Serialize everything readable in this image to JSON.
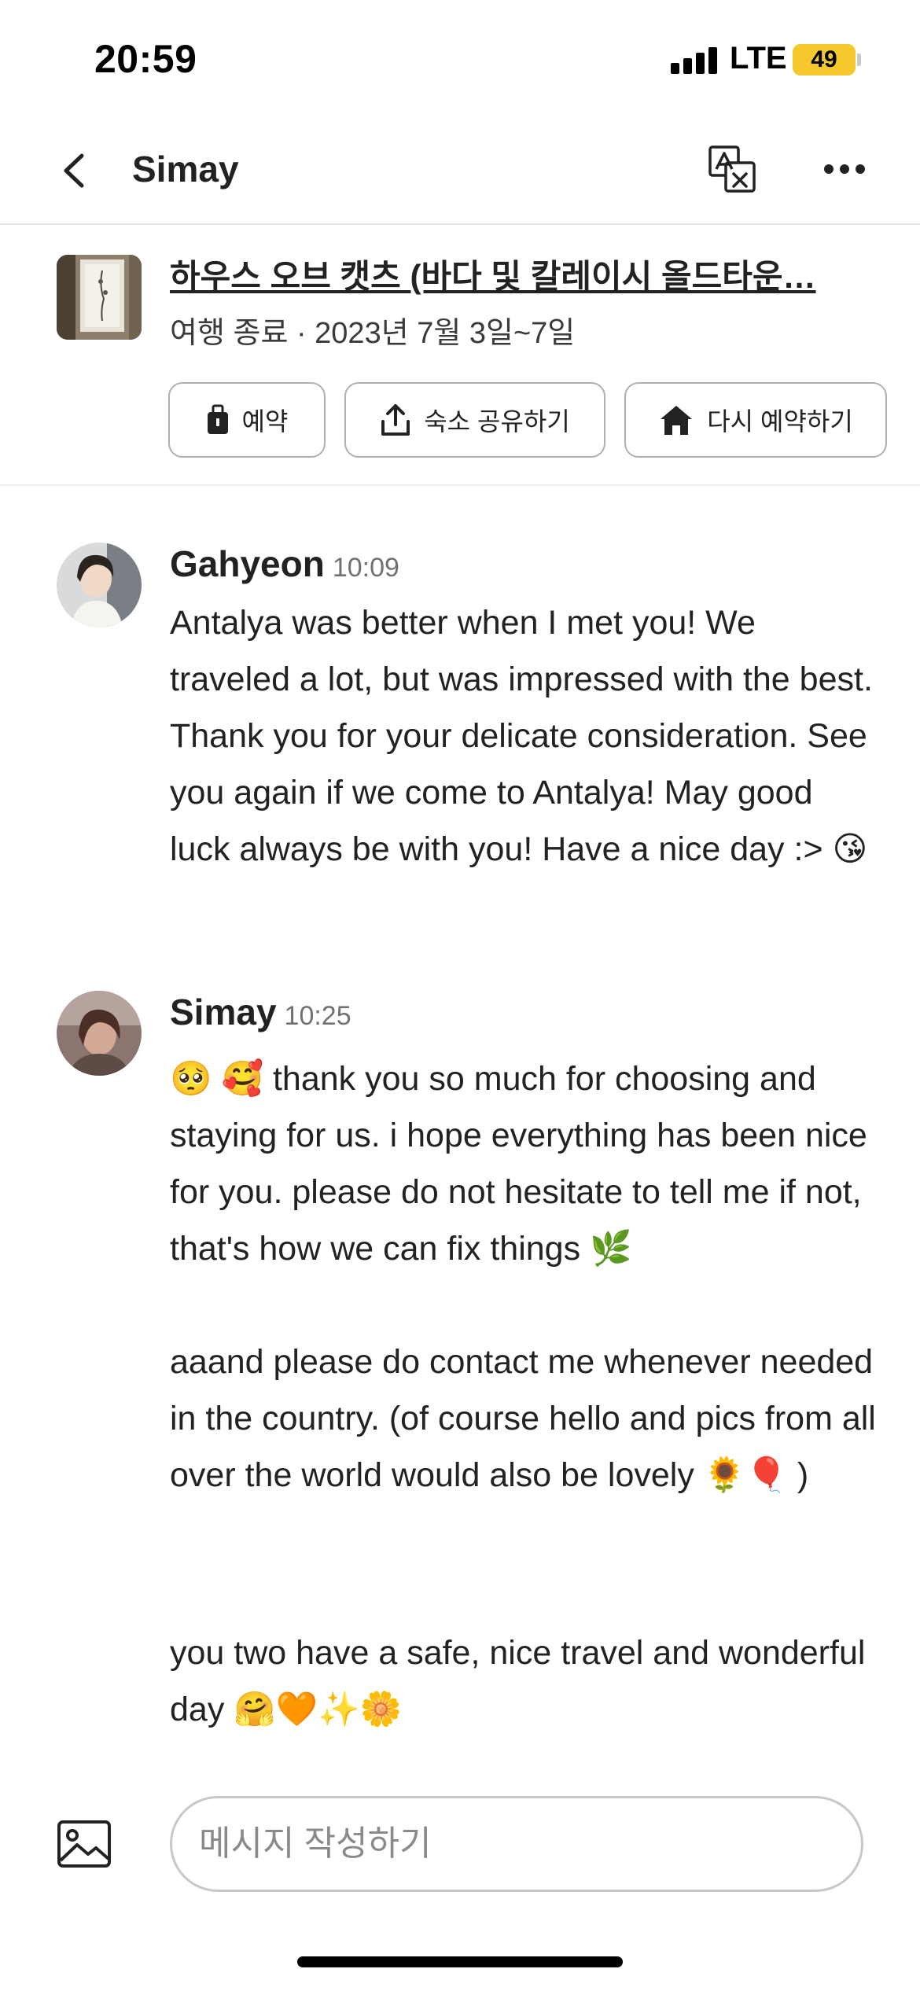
{
  "status_bar": {
    "time": "20:59",
    "network": "LTE",
    "battery": "49"
  },
  "header": {
    "title": "Simay"
  },
  "listing": {
    "title": "하우스 오브 캣츠 (바다 및 칼레이시 올드타운…",
    "subtitle": "여행 종료 · 2023년 7월 3일~7일",
    "actions": {
      "reservation": "예약",
      "share": "숙소 공유하기",
      "rebook": "다시 예약하기"
    }
  },
  "messages": [
    {
      "sender": "Gahyeon",
      "time": "10:09",
      "text": "Antalya was better when I met you! We traveled a lot, but was impressed with the best. Thank you for your delicate consideration. See you again if we come to Antalya! May good luck always be with you! Have a nice day :> 😘"
    },
    {
      "sender": "Simay",
      "time": "10:25",
      "text": "🥺 🥰 thank you so much for choosing and staying for us. i hope everything has been nice for you. please do not hesitate to tell me if not, that's how we can fix things 🌿\n\naaand please do contact me whenever needed in the country. (of course hello and pics from all over the world would also be lovely 🌻🎈 )",
      "text_2": "you two have a safe, nice travel and wonderful day 🤗🧡✨🌼"
    }
  ],
  "compose": {
    "placeholder": "메시지 작성하기"
  },
  "colors": {
    "accent_battery": "#f5c92c",
    "text": "#222222",
    "muted": "#717171",
    "border": "#b0b0b0"
  }
}
